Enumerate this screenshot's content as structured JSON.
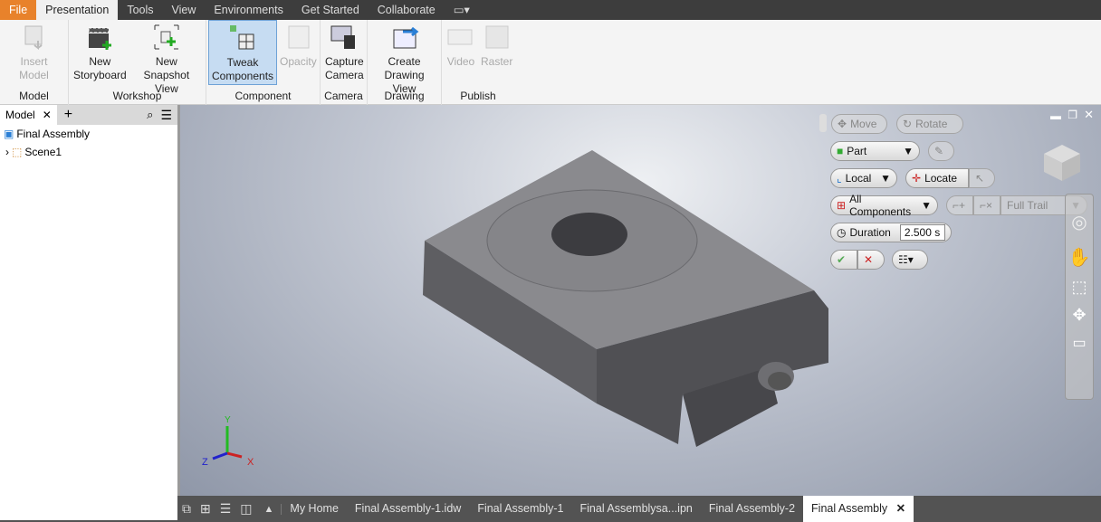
{
  "menu": {
    "file": "File",
    "tabs": [
      "Presentation",
      "Tools",
      "View",
      "Environments",
      "Get Started",
      "Collaborate"
    ]
  },
  "ribbon": {
    "groups": [
      {
        "label": "Model",
        "buttons": [
          {
            "label": "Insert Model",
            "enabled": false
          }
        ]
      },
      {
        "label": "Workshop",
        "buttons": [
          {
            "label": "New Storyboard",
            "l1": "New",
            "l2": "Storyboard"
          },
          {
            "l1": "New",
            "l2": "Snapshot View"
          }
        ]
      },
      {
        "label": "Component",
        "buttons": [
          {
            "l1": "Tweak",
            "l2": "Components",
            "selected": true
          },
          {
            "l1": "Opacity",
            "enabled": false
          }
        ]
      },
      {
        "label": "Camera",
        "buttons": [
          {
            "l1": "Capture",
            "l2": "Camera"
          }
        ]
      },
      {
        "label": "Drawing",
        "buttons": [
          {
            "l1": "Create",
            "l2": "Drawing View"
          }
        ]
      },
      {
        "label": "Publish",
        "buttons": [
          {
            "l1": "Video",
            "enabled": false
          },
          {
            "l1": "Raster",
            "enabled": false
          }
        ]
      }
    ]
  },
  "browser": {
    "tab": "Model",
    "root": "Final Assembly",
    "child": "Scene1"
  },
  "tweak": {
    "move": "Move",
    "rotate": "Rotate",
    "part": "Part",
    "local": "Local",
    "locate": "Locate",
    "all_components": "All Components",
    "full_trail": "Full Trail",
    "duration_label": "Duration",
    "duration_value": "2.500 s"
  },
  "triad": {
    "x": "X",
    "y": "Y",
    "z": "Z"
  },
  "doc_tabs": [
    "My Home",
    "Final Assembly-1.idw",
    "Final Assembly-1",
    "Final Assemblysa...ipn",
    "Final Assembly-2",
    "Final Assembly"
  ],
  "active_tab": "Final Assembly"
}
